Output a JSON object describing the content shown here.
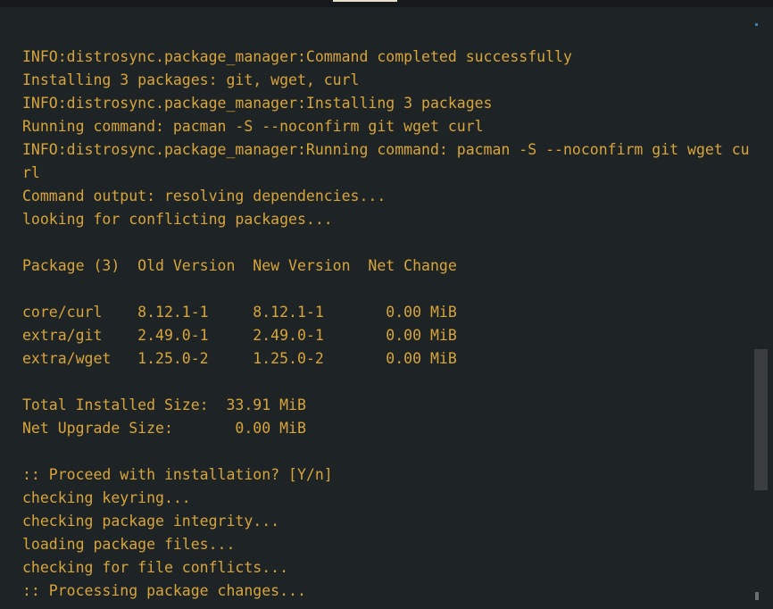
{
  "terminal": {
    "lines": [
      "INFO:distrosync.package_manager:Command completed successfully",
      "Installing 3 packages: git, wget, curl",
      "INFO:distrosync.package_manager:Installing 3 packages",
      "Running command: pacman -S --noconfirm git wget curl",
      "INFO:distrosync.package_manager:Running command: pacman -S --noconfirm git wget cu",
      "rl",
      "Command output: resolving dependencies...",
      "looking for conflicting packages...",
      "",
      "Package (3)  Old Version  New Version  Net Change",
      "",
      "core/curl    8.12.1-1     8.12.1-1       0.00 MiB",
      "extra/git    2.49.0-1     2.49.0-1       0.00 MiB",
      "extra/wget   1.25.0-2     1.25.0-2       0.00 MiB",
      "",
      "Total Installed Size:  33.91 MiB",
      "Net Upgrade Size:       0.00 MiB",
      "",
      ":: Proceed with installation? [Y/n]",
      "checking keyring...",
      "checking package integrity...",
      "loading package files...",
      "checking for file conflicts...",
      ":: Processing package changes..."
    ]
  },
  "colors": {
    "background": "#1e2326",
    "text": "#d7a53a",
    "scrollbar_thumb": "#3a3e41"
  },
  "scroll": {
    "position_fraction": 0.58
  }
}
